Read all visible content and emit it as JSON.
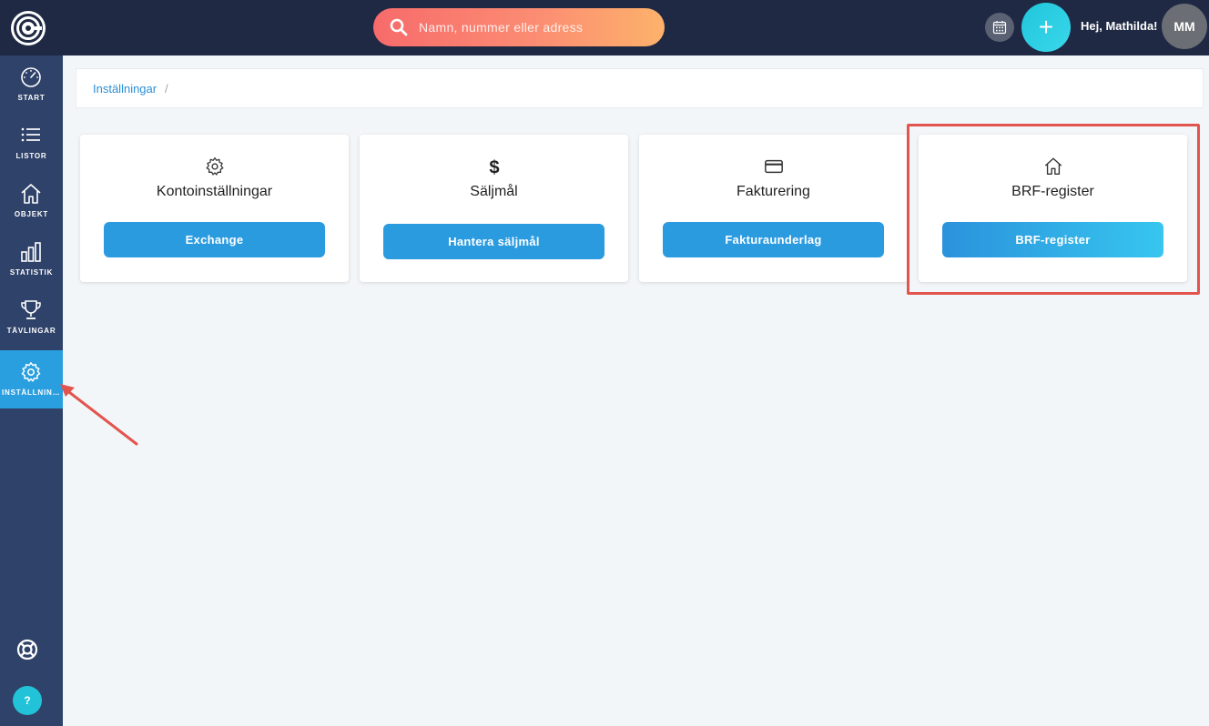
{
  "header": {
    "search_placeholder": "Namn, nummer eller adress",
    "add_label": "+",
    "greeting": "Hej, Mathilda!",
    "avatar_initials": "MM"
  },
  "sidebar": {
    "items": [
      {
        "label": "START",
        "icon": "speedometer-icon"
      },
      {
        "label": "LISTOR",
        "icon": "list-icon"
      },
      {
        "label": "OBJEKT",
        "icon": "house-icon"
      },
      {
        "label": "STATISTIK",
        "icon": "bar-chart-icon"
      },
      {
        "label": "TÄVLINGAR",
        "icon": "trophy-icon"
      },
      {
        "label": "INSTÄLLNINGAR",
        "icon": "gear-icon",
        "active": true
      }
    ],
    "help_label": "?"
  },
  "breadcrumb": {
    "current": "Inställningar",
    "separator": "/"
  },
  "cards": [
    {
      "title": "Kontoinställningar",
      "button": "Exchange",
      "icon": "gear-icon"
    },
    {
      "title": "Säljmål",
      "button": "Hantera säljmål",
      "icon": "dollar-icon"
    },
    {
      "title": "Fakturering",
      "button": "Fakturaunderlag",
      "icon": "credit-card-icon"
    },
    {
      "title": "BRF-register",
      "button": "BRF-register",
      "icon": "house-icon"
    }
  ],
  "colors": {
    "topbar": "#1f2943",
    "sidebar": "#2f4269",
    "active": "#2a9fe0",
    "button": "#2b9be0",
    "annotation": "#e2554e"
  }
}
